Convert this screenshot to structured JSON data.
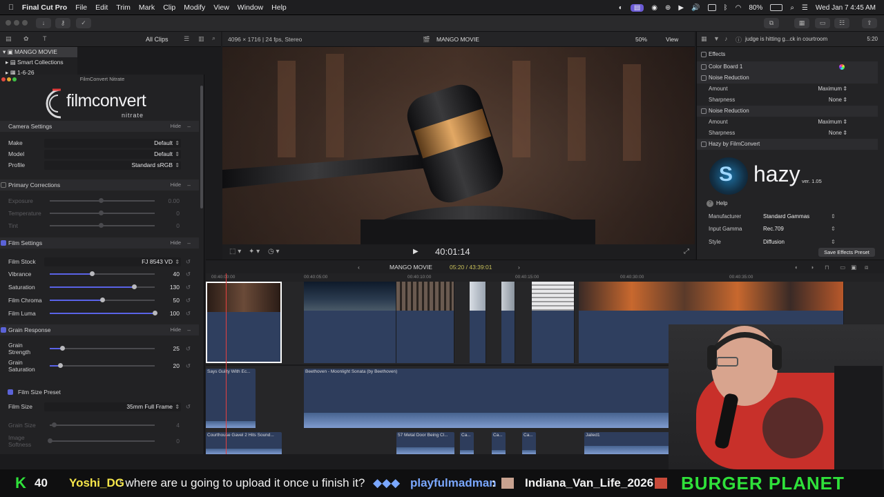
{
  "menubar": {
    "app": "Final Cut Pro",
    "items": [
      "File",
      "Edit",
      "Trim",
      "Mark",
      "Clip",
      "Modify",
      "View",
      "Window",
      "Help"
    ],
    "battery": "80%",
    "datetime": "Wed Jan 7  4:45 AM"
  },
  "library": {
    "filter": "All Clips",
    "tree": [
      "MANGO MOVIE",
      "Smart Collections",
      "1-6-26"
    ]
  },
  "filmconvert": {
    "window_title": "FilmConvert Nitrate",
    "logo_main": "filmconvert",
    "logo_sub": "nitrate",
    "hide_label": "Hide",
    "camera": {
      "title": "Camera Settings",
      "make_label": "Make",
      "make_value": "Default",
      "model_label": "Model",
      "model_value": "Default",
      "profile_label": "Profile",
      "profile_value": "Standard sRGB"
    },
    "primary": {
      "title": "Primary Corrections",
      "rows": [
        {
          "label": "Exposure",
          "value": "0.00",
          "pos": 0.49
        },
        {
          "label": "Temperature",
          "value": "0",
          "pos": 0.49
        },
        {
          "label": "Tint",
          "value": "0",
          "pos": 0.49
        }
      ]
    },
    "film": {
      "title": "Film Settings",
      "stock_label": "Film Stock",
      "stock_value": "FJ 8543 VD",
      "rows": [
        {
          "label": "Vibrance",
          "value": "40",
          "pos": 0.4
        },
        {
          "label": "Saturation",
          "value": "130",
          "pos": 0.8
        },
        {
          "label": "Film Chroma",
          "value": "50",
          "pos": 0.5
        },
        {
          "label": "Film Luma",
          "value": "100",
          "pos": 1.0
        }
      ]
    },
    "grain": {
      "title": "Grain Response",
      "rows": [
        {
          "label": "Grain Strength",
          "value": "25",
          "pos": 0.12
        },
        {
          "label": "Grain Saturation",
          "value": "20",
          "pos": 0.1
        }
      ]
    },
    "size": {
      "title": "Film Size Preset",
      "size_label": "Film Size",
      "size_value": "35mm Full Frame",
      "rows": [
        {
          "label": "Grain Size",
          "value": "4",
          "pos": 0.04
        },
        {
          "label": "Image Softness",
          "value": "0",
          "pos": 0.0
        }
      ]
    }
  },
  "viewer": {
    "format": "4096 × 1716 | 24 fps, Stereo",
    "title": "MANGO MOVIE",
    "zoom": "50%",
    "view": "View",
    "timecode": "40:01:14"
  },
  "inspector": {
    "clip_name": "judge is hitting g...ck in courtroom",
    "duration": "5:20",
    "effects_label": "Effects",
    "items": [
      {
        "name": "Color Board 1",
        "type": "hdr"
      },
      {
        "name": "Noise Reduction",
        "type": "hdr"
      },
      {
        "name": "Amount",
        "value": "Maximum",
        "type": "param"
      },
      {
        "name": "Sharpness",
        "value": "None",
        "type": "param"
      },
      {
        "name": "Noise Reduction",
        "type": "hdr"
      },
      {
        "name": "Amount",
        "value": "Maximum",
        "type": "param"
      },
      {
        "name": "Sharpness",
        "value": "None",
        "type": "param"
      },
      {
        "name": "Hazy by FilmConvert",
        "type": "hdr"
      }
    ],
    "hazy_logo": "hazy",
    "hazy_version": "ver. 1.05",
    "help": "Help",
    "manufacturer_label": "Manufacturer",
    "manufacturer_value": "Standard Gammas",
    "gamma_label": "Input Gamma",
    "gamma_value": "Rec.709",
    "style_label": "Style",
    "style_value": "Diffusion",
    "save_preset": "Save Effects Preset"
  },
  "timeline": {
    "project": "MANGO MOVIE",
    "position": "05:20 / 43:39:01",
    "ruler": [
      "00:40:00:00",
      "00:40:05:00",
      "00:40:10:00",
      "00:40:15:00",
      "00:40:30:00",
      "00:40:35:00"
    ],
    "audio_clips": [
      "Says Guilty With Ec...",
      "Beethoven - Moonlight Sonata (by Beethoven)",
      "Courthouse Gavel 2 Hits Sound...",
      "57 Metal Door Being Cl...",
      "Ca...",
      "Ca...",
      "Ca...",
      "Jailed1"
    ]
  },
  "ticker": {
    "badge": "K",
    "count": "40",
    "user1": "Yoshi_DG",
    "msg1": " : where are u going to upload it once u finish it?",
    "user2": "playfulmadman",
    "sep": " : ",
    "user3": "Indiana_Van_Life_2026",
    "brand": "BURGER PLANET"
  },
  "colors": {
    "accent": "#5a63e8",
    "ticker_yellow": "#f6e64a",
    "ticker_blue": "#7aa7ff",
    "ticker_green": "#2fe13a"
  }
}
